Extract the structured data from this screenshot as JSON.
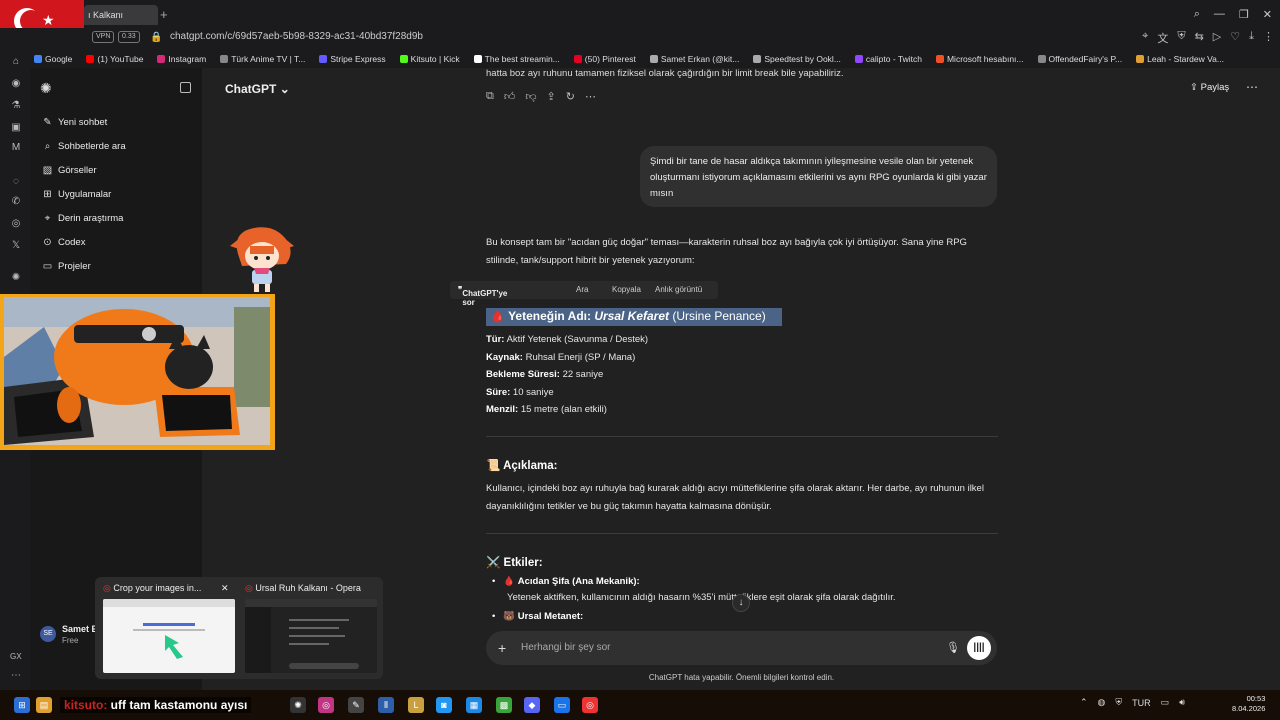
{
  "browser": {
    "active_tab_title": "ı Kalkanı",
    "new_tab_glyph": "+",
    "url": "chatgpt.com/c/69d57aeb-5b98-8329-ac31-40bd37f28d9b",
    "vpn_label": "VPN",
    "badge_label": "0.33",
    "bookmarks": [
      {
        "label": "Google",
        "color": "#4285f4"
      },
      {
        "label": "(1) YouTube",
        "color": "#ff0000"
      },
      {
        "label": "Instagram",
        "color": "#d62976"
      },
      {
        "label": "Türk Anime TV | T...",
        "color": "#888888"
      },
      {
        "label": "Stripe Express",
        "color": "#635bff"
      },
      {
        "label": "Kitsuto | Kick",
        "color": "#53fc18"
      },
      {
        "label": "The best streamin...",
        "color": "#ffffff"
      },
      {
        "label": "(50) Pinterest",
        "color": "#e60023"
      },
      {
        "label": "Samet Erkan (@kit...",
        "color": "#aaaaaa"
      },
      {
        "label": "Speedtest by Ookl...",
        "color": "#aaaaaa"
      },
      {
        "label": "calipto - Twitch",
        "color": "#9146ff"
      },
      {
        "label": "Microsoft hesabını...",
        "color": "#f25022"
      },
      {
        "label": "OffendedFairy's P...",
        "color": "#888888"
      },
      {
        "label": "Leah - Stardew Va...",
        "color": "#e0a030"
      }
    ]
  },
  "sidebar": {
    "items": [
      {
        "label": "Yeni sohbet",
        "icon": "edit-icon"
      },
      {
        "label": "Sohbetlerde ara",
        "icon": "search-icon"
      },
      {
        "label": "Görseller",
        "icon": "image-icon"
      },
      {
        "label": "Uygulamalar",
        "icon": "apps-icon"
      },
      {
        "label": "Derin araştırma",
        "icon": "telescope-icon"
      },
      {
        "label": "Codex",
        "icon": "codex-icon"
      },
      {
        "label": "Projeler",
        "icon": "folder-icon"
      }
    ],
    "user": {
      "initials": "SE",
      "name": "Samet E",
      "plan": "Free"
    },
    "gx": "GX"
  },
  "header": {
    "model": "ChatGPT",
    "share": "Paylaş"
  },
  "conversation": {
    "prev_tail": "hatta boz ayı ruhunu tamamen fiziksel olarak çağırdığın bir limit break bile yapabiliriz.",
    "user_message": "Şimdi bir tane de hasar aldıkça takımının iyileşmesine vesile olan bir yetenek oluşturmanı istiyorum açıklamasını etkilerini vs aynı RPG oyunlarda ki gibi yazar mısın",
    "intro": "Bu konsept tam bir \"acıdan güç doğar\" teması—karakterin ruhsal boz ayı bağıyla çok iyi örtüşüyor. Sana yine RPG stilinde, tank/support hibrit bir yetenek yazıyorum:",
    "ask_tooltip": {
      "ask": "ChatGPT'ye sor",
      "search": "Ara",
      "copy": "Kopyala",
      "snapshot": "Anlık görüntü"
    },
    "skill_title": {
      "emoji": "🩸",
      "prefix": "Yeteneğin Adı: ",
      "name": "Ursal Kefaret",
      "suffix": " (Ursine Penance)"
    },
    "attributes": [
      {
        "key": "Tür:",
        "value": " Aktif Yetenek (Savunma / Destek)"
      },
      {
        "key": "Kaynak:",
        "value": " Ruhsal Enerji (SP / Mana)"
      },
      {
        "key": "Bekleme Süresi:",
        "value": " 22 saniye"
      },
      {
        "key": "Süre:",
        "value": " 10 saniye"
      },
      {
        "key": "Menzil:",
        "value": " 15 metre (alan etkili)"
      }
    ],
    "desc_heading": {
      "emoji": "📜",
      "label": "Açıklama:"
    },
    "description": "Kullanıcı, içindeki boz ayı ruhuyla bağ kurarak aldığı acıyı müttefiklerine şifa olarak aktarır. Her darbe, ayı ruhunun ilkel dayanıklılığını tetikler ve bu güç takımın hayatta kalmasına dönüşür.",
    "effects_heading": {
      "emoji": "⚔️",
      "label": "Etkiler:"
    },
    "effects": [
      {
        "emoji": "🩸",
        "title": "Acıdan Şifa (Ana Mekanik):",
        "text": "Yetenek aktifken, kullanıcının aldığı hasarın %35'i müttefiklere eşit olarak şifa olarak dağıtılır."
      },
      {
        "emoji": "🐻",
        "title": "Ursal Metanet:",
        "text": ""
      }
    ]
  },
  "composer": {
    "placeholder": "Herhangi bir şey sor",
    "disclaimer": "ChatGPT hata yapabilir. Önemli bilgileri kontrol edin."
  },
  "tab_previews": [
    {
      "title": "Crop your images in..."
    },
    {
      "title": "Ursal Ruh Kalkanı - Opera"
    }
  ],
  "stream_overlay": {
    "name": "kitsuto:",
    "message": " uff tam kastamonu ayısı"
  },
  "taskbar": {
    "lang": "TUR",
    "time": "00:53",
    "date": "8.04.2026"
  }
}
